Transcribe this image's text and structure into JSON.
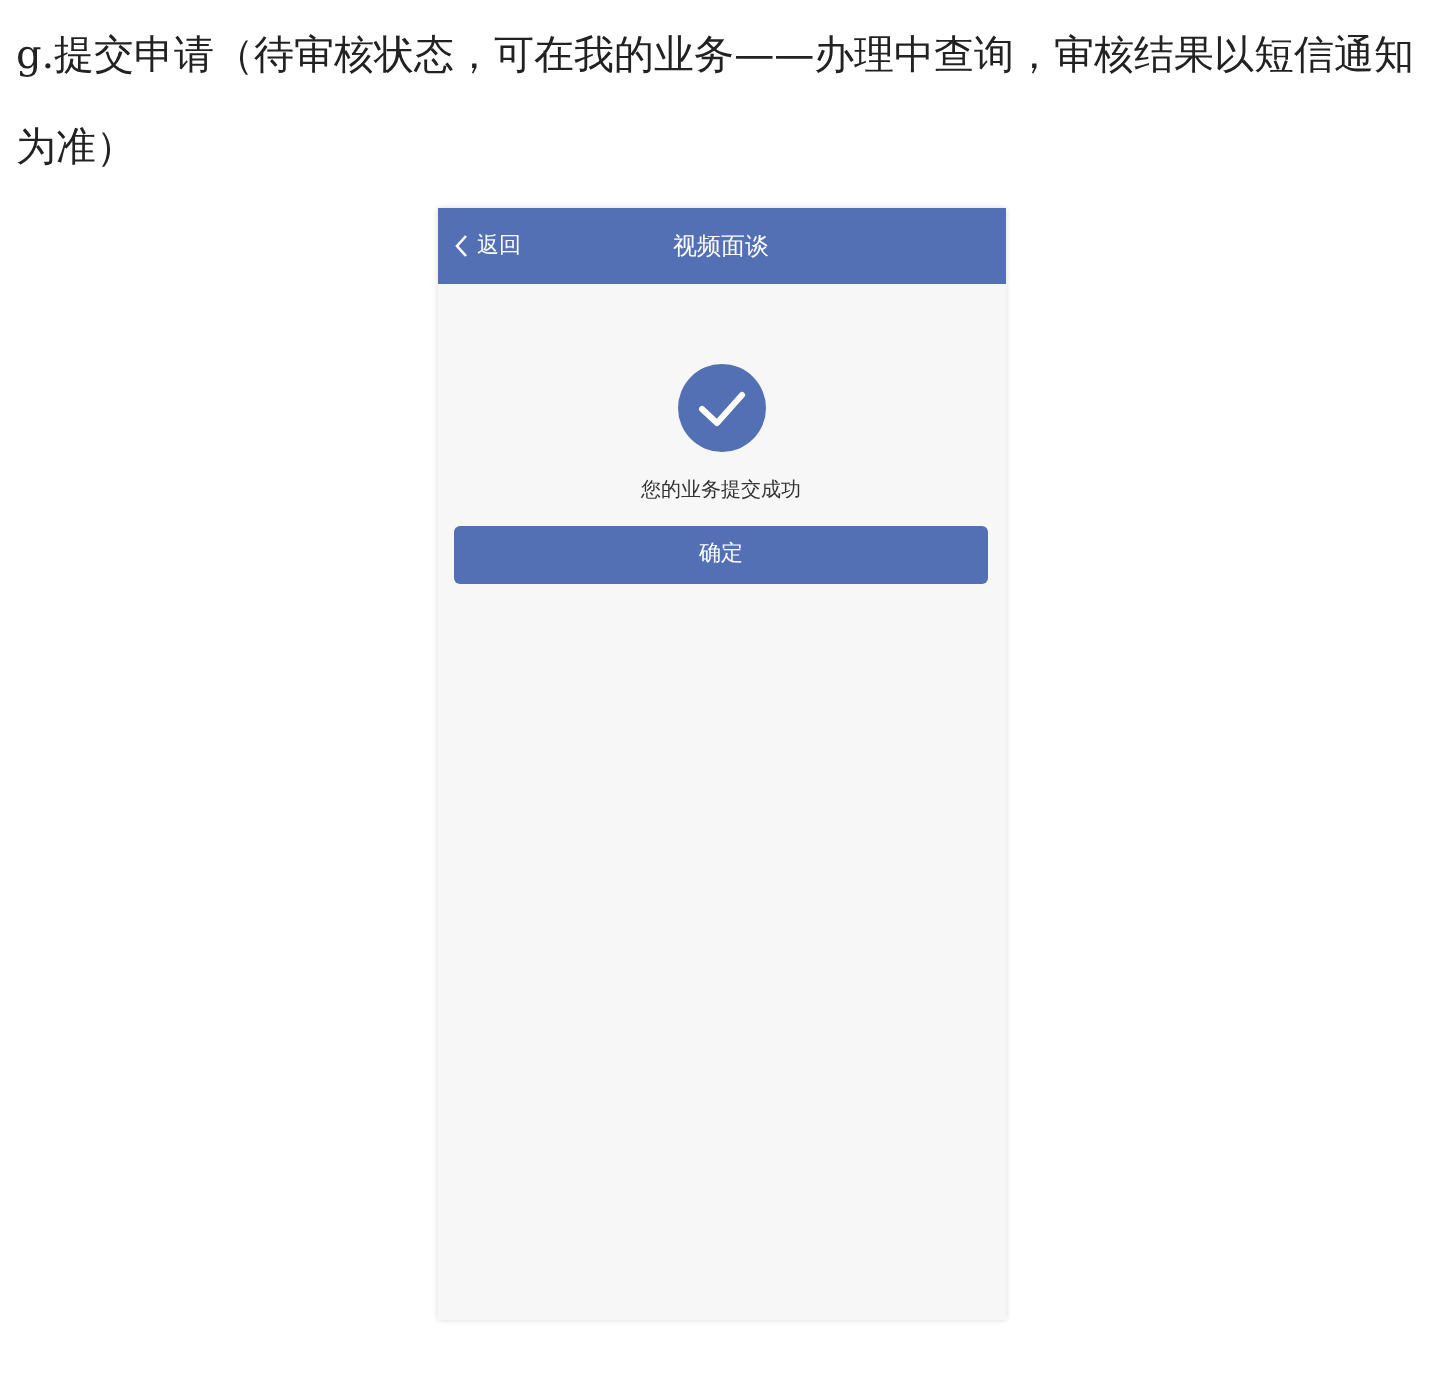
{
  "caption": "g.提交申请（待审核状态，可在我的业务——办理中查询，审核结果以短信通知为准）",
  "phone": {
    "header": {
      "back": "返回",
      "title": "视频面谈"
    },
    "message": "您的业务提交成功",
    "button": "确定"
  }
}
